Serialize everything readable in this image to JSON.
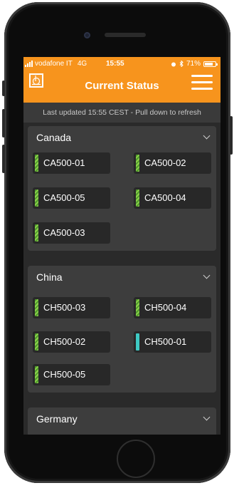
{
  "status_bar": {
    "carrier": "vodafone IT",
    "network": "4G",
    "time": "15:55",
    "battery": "71%"
  },
  "header": {
    "title": "Current Status",
    "logo_icon": "app-logo-icon",
    "menu_icon": "hamburger-menu-icon",
    "accent_color": "#f7941d"
  },
  "refresh_notice": "Last updated 15:55 CEST - Pull down to refresh",
  "groups": [
    {
      "name": "Canada",
      "devices": [
        {
          "id": "CA500-01",
          "status": "ok"
        },
        {
          "id": "CA500-02",
          "status": "ok"
        },
        {
          "id": "CA500-05",
          "status": "ok"
        },
        {
          "id": "CA500-04",
          "status": "ok"
        },
        {
          "id": "CA500-03",
          "status": "ok"
        }
      ]
    },
    {
      "name": "China",
      "devices": [
        {
          "id": "CH500-03",
          "status": "ok"
        },
        {
          "id": "CH500-04",
          "status": "ok"
        },
        {
          "id": "CH500-02",
          "status": "ok"
        },
        {
          "id": "CH500-01",
          "status": "alert"
        },
        {
          "id": "CH500-05",
          "status": "ok"
        }
      ]
    },
    {
      "name": "Germany",
      "devices": []
    }
  ],
  "status_colors": {
    "ok": "#54a332",
    "alert": "#3ec9c3"
  }
}
